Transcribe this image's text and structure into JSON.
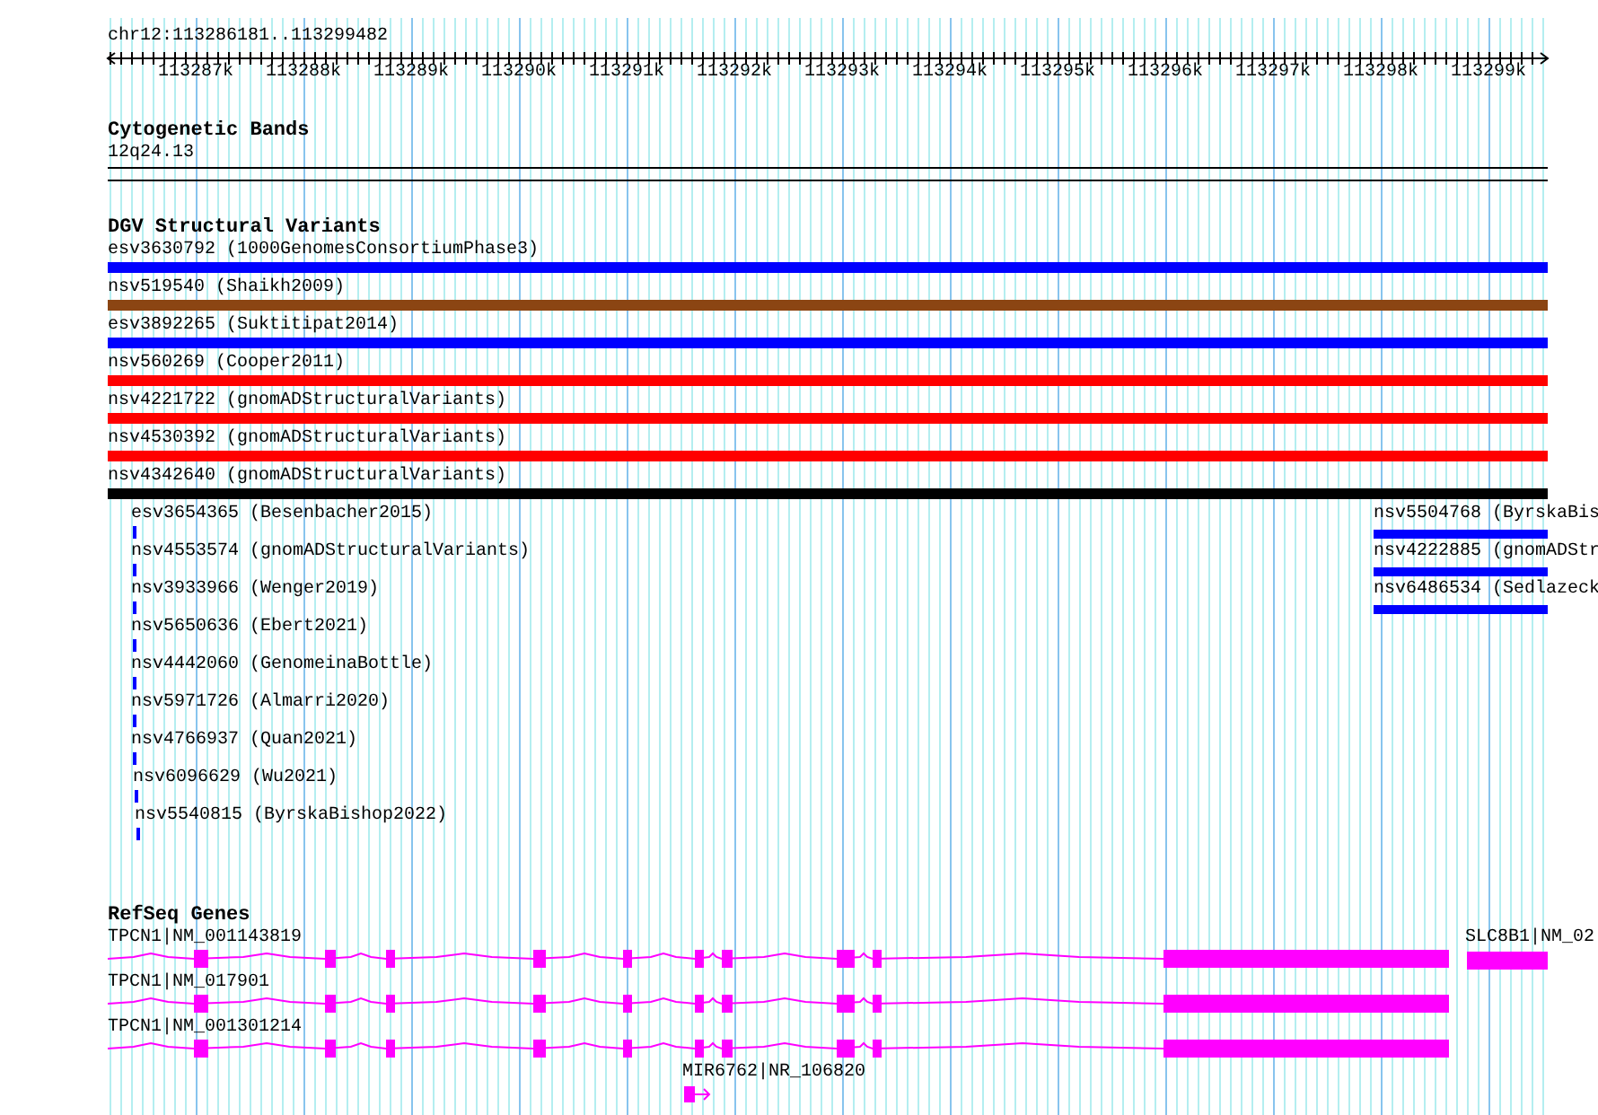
{
  "ruler": {
    "location": "chr12:113286181..113299482",
    "ticks": [
      "113287k",
      "113288k",
      "113289k",
      "113290k",
      "113291k",
      "113292k",
      "113293k",
      "113294k",
      "113295k",
      "113296k",
      "113297k",
      "113298k",
      "113299k"
    ]
  },
  "tracks": [
    {
      "kind": "bands",
      "title": "Cytogenetic Bands",
      "features": [
        {
          "label": "12q24.13"
        }
      ]
    },
    {
      "kind": "variants",
      "title": "DGV Structural Variants",
      "features": [
        {
          "label": "esv3630792 (1000GenomesConsortiumPhase3)",
          "color": "#0000ff"
        },
        {
          "label": "nsv519540 (Shaikh2009)",
          "color": "#8b4513"
        },
        {
          "label": "esv3892265 (Suktitipat2014)",
          "color": "#0000ff"
        },
        {
          "label": "nsv560269 (Cooper2011)",
          "color": "#ff0000"
        },
        {
          "label": "nsv4221722 (gnomADStructuralVariants)",
          "color": "#ff0000"
        },
        {
          "label": "nsv4530392 (gnomADStructuralVariants)",
          "color": "#ff0000"
        },
        {
          "label": "nsv4342640 (gnomADStructuralVariants)",
          "color": "#000000"
        },
        {
          "label": "esv3654365 (Besenbacher2015)",
          "color": "#0000ff"
        },
        {
          "label": "nsv4553574 (gnomADStructuralVariants)",
          "color": "#0000ff"
        },
        {
          "label": "nsv3933966 (Wenger2019)",
          "color": "#0000ff"
        },
        {
          "label": "nsv5650636 (Ebert2021)",
          "color": "#0000ff"
        },
        {
          "label": "nsv4442060 (GenomeinaBottle)",
          "color": "#0000ff"
        },
        {
          "label": "nsv5971726 (Almarri2020)",
          "color": "#0000ff"
        },
        {
          "label": "nsv4766937 (Quan2021)",
          "color": "#0000ff"
        },
        {
          "label": "nsv6096629 (Wu2021)",
          "color": "#0000ff"
        },
        {
          "label": "nsv5540815 (ByrskaBishop2022)",
          "color": "#0000ff"
        },
        {
          "label": "nsv5504768 (ByrskaBis",
          "color": "#0000ff"
        },
        {
          "label": "nsv4222885 (gnomADStr",
          "color": "#0000ff"
        },
        {
          "label": "nsv6486534 (Sedlazeck",
          "color": "#0000ff"
        }
      ]
    },
    {
      "kind": "genes",
      "title": "RefSeq Genes",
      "features": [
        {
          "label": "TPCN1|NM_001143819"
        },
        {
          "label": "TPCN1|NM_017901"
        },
        {
          "label": "TPCN1|NM_001301214"
        },
        {
          "label": "SLC8B1|NM_02"
        },
        {
          "label": "MIR6762|NR_106820"
        }
      ]
    }
  ]
}
